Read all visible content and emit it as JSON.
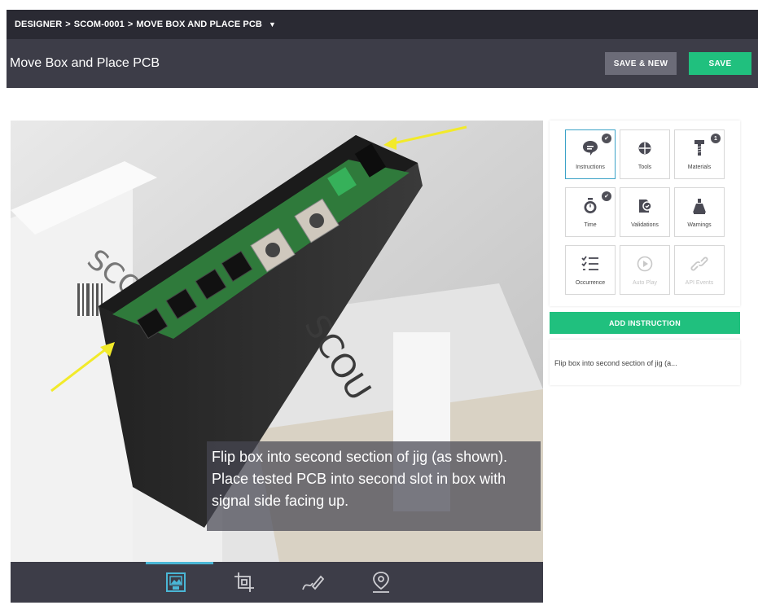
{
  "breadcrumb": {
    "items": [
      "DESIGNER",
      "SCOM-0001",
      "MOVE BOX AND PLACE PCB"
    ],
    "separator": ">",
    "caret_icon": "caret-down-icon"
  },
  "header": {
    "title": "Move Box and Place PCB",
    "save_new_label": "SAVE & NEW",
    "save_label": "SAVE"
  },
  "photo": {
    "caption": "Flip box into second section of jig (as shown). Place tested PCB into second slot in box with signal side facing up."
  },
  "bottom_toolbar": {
    "icons": [
      "image-edit-icon",
      "crop-icon",
      "draw-icon",
      "location-pin-icon"
    ],
    "active_index": 0
  },
  "tiles": [
    {
      "label": "Instructions",
      "icon": "speech-bubble-icon",
      "badge": "✔",
      "active": true,
      "disabled": false
    },
    {
      "label": "Tools",
      "icon": "crosshair-icon",
      "badge": "",
      "active": false,
      "disabled": false
    },
    {
      "label": "Materials",
      "icon": "screw-icon",
      "badge": "1",
      "active": false,
      "disabled": false
    },
    {
      "label": "Time",
      "icon": "stopwatch-icon",
      "badge": "✔",
      "active": false,
      "disabled": false
    },
    {
      "label": "Validations",
      "icon": "validation-icon",
      "badge": "",
      "active": false,
      "disabled": false
    },
    {
      "label": "Warnings",
      "icon": "warning-flask-icon",
      "badge": "",
      "active": false,
      "disabled": false
    },
    {
      "label": "Occurrence",
      "icon": "checklist-icon",
      "badge": "",
      "active": false,
      "disabled": false
    },
    {
      "label": "Auto Play",
      "icon": "play-icon",
      "badge": "",
      "active": false,
      "disabled": true
    },
    {
      "label": "API Events",
      "icon": "link-icon",
      "badge": "",
      "active": false,
      "disabled": true
    }
  ],
  "add_instruction_label": "ADD INSTRUCTION",
  "instructions": [
    {
      "text": "Flip box into second section of jig (a..."
    }
  ],
  "colors": {
    "accent_green": "#20c07e",
    "topbar": "#2a2a33",
    "titlebar": "#3d3d48",
    "active_blue": "#3ba2c7"
  }
}
